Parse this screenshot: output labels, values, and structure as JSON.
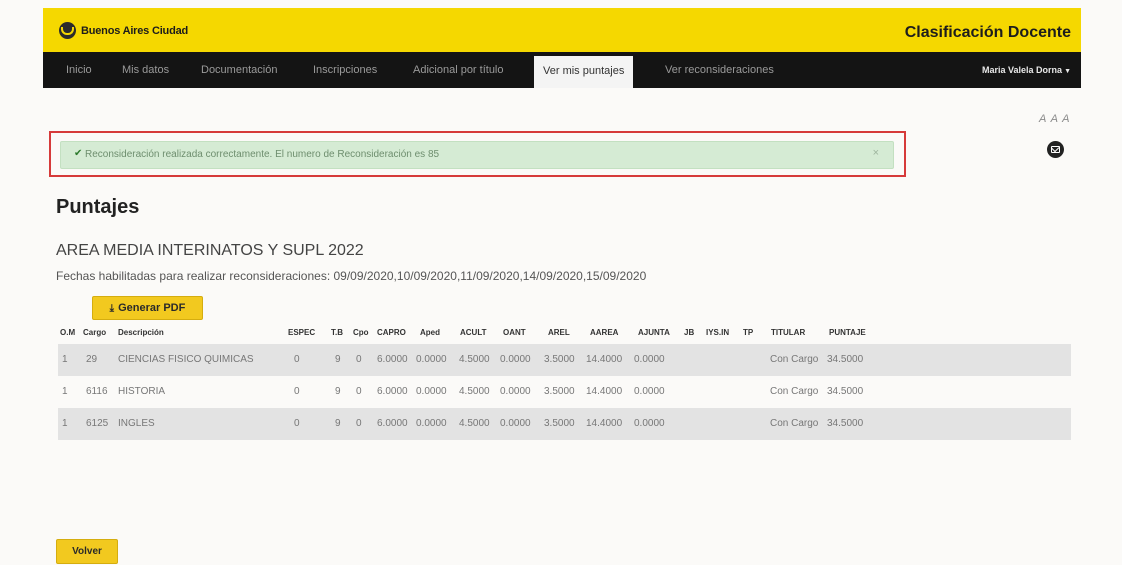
{
  "brand": {
    "name": "Buenos Aires Ciudad",
    "app_title": "Clasificación Docente"
  },
  "nav": {
    "items": [
      "Inicio",
      "Mis datos",
      "Documentación",
      "Inscripciones",
      "Adicional por título",
      "Ver mis puntajes",
      "Ver reconsideraciones"
    ],
    "active": "Ver mis puntajes",
    "user": "Maria Valela Dorna"
  },
  "accessibility": {
    "font_sizers": "A A A"
  },
  "icons": {
    "download": "download-icon",
    "mail": "mail-icon",
    "check": "check-icon",
    "close": "close-icon"
  },
  "alert": {
    "check": "✔",
    "message": "Reconsideración realizada correctamente. El numero de Reconsideración es 85",
    "close": "×"
  },
  "page": {
    "title": "Puntajes",
    "area": "AREA MEDIA INTERINATOS Y SUPL 2022",
    "dates_label": "Fechas habilitadas para realizar reconsideraciones:",
    "dates": "09/09/2020,10/09/2020,11/09/2020,14/09/2020,15/09/2020"
  },
  "buttons": {
    "pdf": "Generar PDF",
    "back": "Volver"
  },
  "table": {
    "headers": [
      "O.M",
      "Cargo",
      "Descripción",
      "ESPEC",
      "T.B",
      "Cpo",
      "CAPRO",
      "Aped",
      "ACULT",
      "OANT",
      "AREL",
      "AAREA",
      "AJUNTA",
      "JB",
      "IYS.IN",
      "TP",
      "TITULAR",
      "PUNTAJE"
    ],
    "rows": [
      [
        "1",
        "29",
        "CIENCIAS FISICO QUIMICAS",
        "0",
        "9",
        "0",
        "6.0000",
        "0.0000",
        "4.5000",
        "0.0000",
        "3.5000",
        "14.4000",
        "0.0000",
        "",
        "",
        "",
        "Con Cargo",
        "34.5000"
      ],
      [
        "1",
        "6116",
        "HISTORIA",
        "0",
        "9",
        "0",
        "6.0000",
        "0.0000",
        "4.5000",
        "0.0000",
        "3.5000",
        "14.4000",
        "0.0000",
        "",
        "",
        "",
        "Con Cargo",
        "34.5000"
      ],
      [
        "1",
        "6125",
        "INGLES",
        "0",
        "9",
        "0",
        "6.0000",
        "0.0000",
        "4.5000",
        "0.0000",
        "3.5000",
        "14.4000",
        "0.0000",
        "",
        "",
        "",
        "Con Cargo",
        "34.5000"
      ]
    ]
  },
  "colors": {
    "brand_yellow": "#f5d800",
    "nav_dark": "#141414",
    "alert_green": "#d5ebd4",
    "highlight_red": "#d63a3a",
    "button_yellow": "#f2c91f"
  }
}
